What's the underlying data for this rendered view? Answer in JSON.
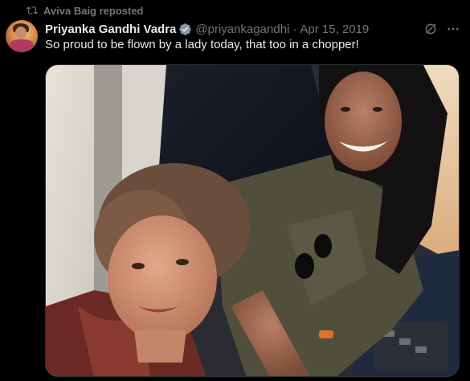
{
  "repost": {
    "label": "Aviva Baig reposted",
    "icon": "repost-icon"
  },
  "author": {
    "display_name": "Priyanka Gandhi Vadra",
    "verified": true,
    "handle": "@priyankagandhi",
    "separator": "·",
    "date": "Apr 15, 2019"
  },
  "actions": {
    "grok_icon": "grok-icon",
    "more_icon": "more-icon"
  },
  "tweet": {
    "text": "So proud to be flown by a lady today, that too in a chopper!"
  },
  "colors": {
    "background": "#000000",
    "text_primary": "#e7e9ea",
    "text_secondary": "#71767b",
    "verified_blue": "#1d9bf0",
    "border": "#2f3336"
  }
}
